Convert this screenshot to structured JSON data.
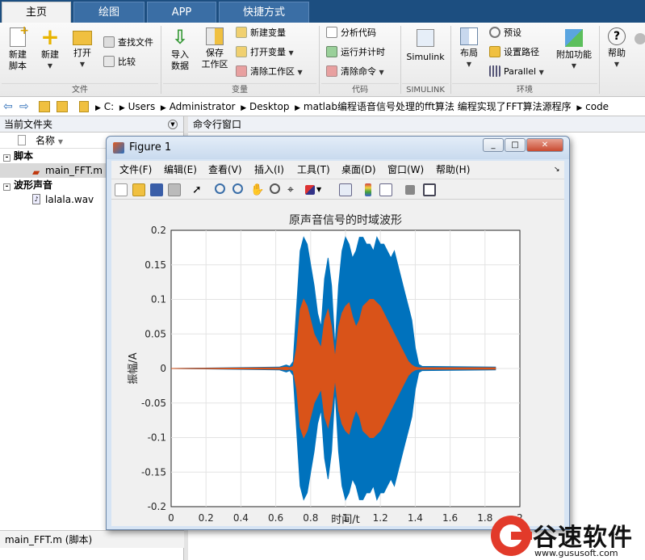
{
  "tabs": [
    "主页",
    "绘图",
    "APP",
    "快捷方式"
  ],
  "ribbon": {
    "new_script": "新建\n脚本",
    "new": "新建",
    "open": "打开",
    "find_files": "查找文件",
    "compare": "比较",
    "import_data": "导入\n数据",
    "save_workspace": "保存\n工作区",
    "new_variable": "新建变量",
    "open_variable": "打开变量",
    "clear_workspace": "清除工作区",
    "analyze_code": "分析代码",
    "run_and_time": "运行并计时",
    "clear_commands": "清除命令",
    "simulink": "Simulink",
    "layout": "布局",
    "preferences": "预设",
    "set_path": "设置路径",
    "parallel": "Parallel",
    "addons": "附加功能",
    "help": "帮助",
    "groups": {
      "file": "文件",
      "variable": "变量",
      "code": "代码",
      "simulink": "SIMULINK",
      "environment": "环境"
    }
  },
  "address": {
    "path": [
      "C:",
      "Users",
      "Administrator",
      "Desktop",
      "matlab编程语音信号处理的fft算法 编程实现了FFT算法源程序",
      "code"
    ]
  },
  "left_panel": {
    "title": "当前文件夹",
    "column": "名称",
    "groups": [
      {
        "label": "脚本",
        "items": [
          "main_FFT.m"
        ]
      },
      {
        "label": "波形声音",
        "items": [
          "lalala.wav"
        ]
      }
    ],
    "status": "main_FFT.m  (脚本)"
  },
  "command_window": {
    "title": "命令行窗口"
  },
  "figure": {
    "title": "Figure 1",
    "menu": [
      "文件(F)",
      "编辑(E)",
      "查看(V)",
      "插入(I)",
      "工具(T)",
      "桌面(D)",
      "窗口(W)",
      "帮助(H)"
    ]
  },
  "chart_data": {
    "type": "area",
    "title": "原声音信号的时域波形",
    "xlabel": "时间/t",
    "ylabel": "振幅/A",
    "xlim": [
      0,
      2
    ],
    "ylim": [
      -0.2,
      0.2
    ],
    "xticks": [
      "0",
      "0.2",
      "0.4",
      "0.6",
      "0.8",
      "1",
      "1.2",
      "1.4",
      "1.6",
      "1.8",
      "2"
    ],
    "yticks": [
      "0.2",
      "0.15",
      "0.1",
      "0.05",
      "0",
      "-0.05",
      "-0.1",
      "-0.15",
      "-0.2"
    ],
    "grid": true,
    "series": [
      {
        "color": "#0072bd",
        "x": [
          0,
          0.62,
          0.66,
          0.68,
          0.7,
          0.72,
          0.74,
          0.76,
          0.78,
          0.8,
          0.82,
          0.84,
          0.86,
          0.88,
          0.9,
          0.92,
          0.94,
          0.96,
          0.98,
          1.0,
          1.02,
          1.04,
          1.06,
          1.08,
          1.1,
          1.12,
          1.14,
          1.16,
          1.18,
          1.2,
          1.22,
          1.24,
          1.26,
          1.28,
          1.3,
          1.32,
          1.34,
          1.36,
          1.38,
          1.4,
          1.42,
          1.44,
          1.86
        ],
        "y": [
          0,
          0.002,
          0.005,
          0.003,
          0.01,
          0.09,
          0.17,
          0.19,
          0.18,
          0.15,
          0.12,
          0.08,
          0.06,
          0.13,
          0.16,
          0.12,
          0.03,
          0.12,
          0.17,
          0.19,
          0.18,
          0.16,
          0.17,
          0.19,
          0.19,
          0.18,
          0.18,
          0.17,
          0.19,
          0.18,
          0.18,
          0.17,
          0.16,
          0.17,
          0.15,
          0.13,
          0.11,
          0.09,
          0.07,
          0.03,
          0.006,
          0.003,
          0.002
        ]
      },
      {
        "color": "#d95319",
        "x": [
          0,
          0.62,
          0.66,
          0.68,
          0.7,
          0.72,
          0.74,
          0.76,
          0.78,
          0.8,
          0.82,
          0.84,
          0.86,
          0.88,
          0.9,
          0.92,
          0.94,
          0.96,
          0.98,
          1.0,
          1.02,
          1.04,
          1.06,
          1.08,
          1.1,
          1.12,
          1.14,
          1.16,
          1.18,
          1.2,
          1.22,
          1.24,
          1.26,
          1.28,
          1.3,
          1.32,
          1.34,
          1.36,
          1.38,
          1.4,
          1.42,
          1.44,
          1.86
        ],
        "y": [
          0,
          0.001,
          0.002,
          0.001,
          0.003,
          0.03,
          0.085,
          0.1,
          0.09,
          0.07,
          0.05,
          0.04,
          0.03,
          0.07,
          0.085,
          0.06,
          0.015,
          0.06,
          0.08,
          0.09,
          0.095,
          0.075,
          0.06,
          0.07,
          0.09,
          0.095,
          0.1,
          0.1,
          0.095,
          0.09,
          0.08,
          0.07,
          0.06,
          0.05,
          0.04,
          0.03,
          0.02,
          0.01,
          0.005,
          0.002,
          0.001,
          0.001,
          0.001
        ]
      }
    ]
  }
}
